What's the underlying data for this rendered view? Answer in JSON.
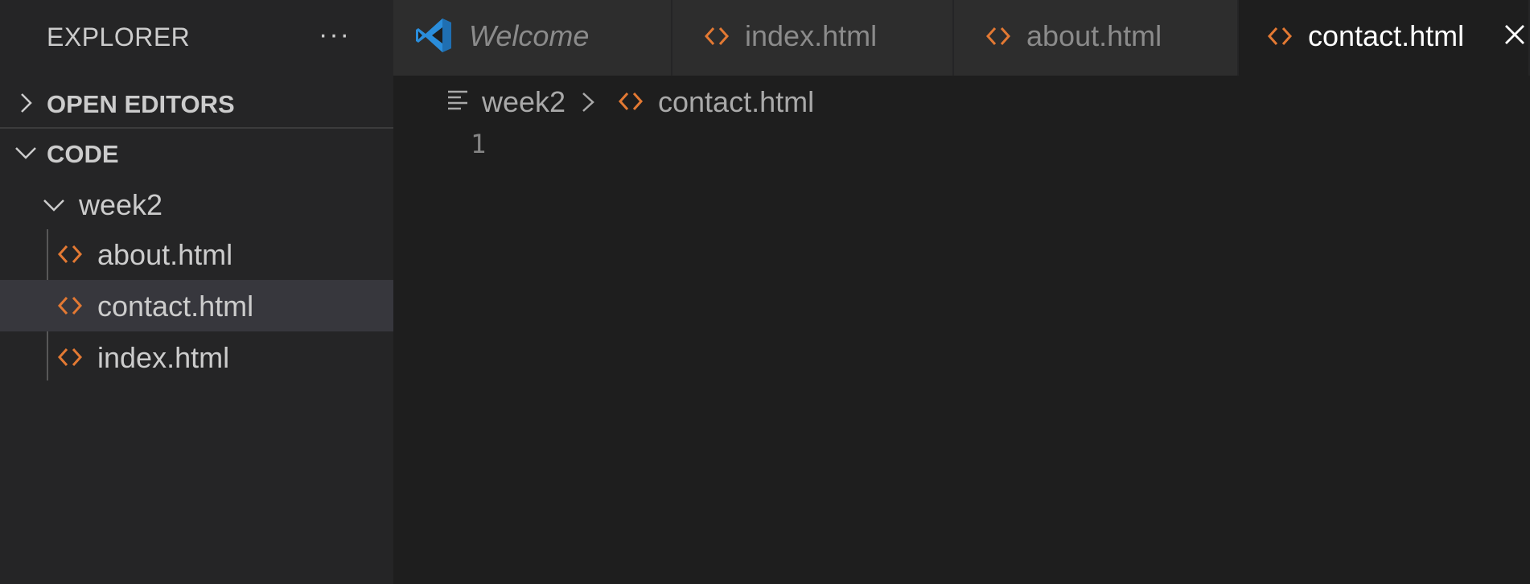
{
  "explorer": {
    "title": "EXPLORER",
    "more_label": "···",
    "sections": {
      "open_editors": "OPEN EDITORS",
      "workspace": "CODE"
    },
    "folder": "week2",
    "files": [
      {
        "name": "about.html",
        "selected": false
      },
      {
        "name": "contact.html",
        "selected": true
      },
      {
        "name": "index.html",
        "selected": false
      }
    ]
  },
  "tabs": [
    {
      "label": "Welcome",
      "icon": "vscode-logo-icon",
      "active": false
    },
    {
      "label": "index.html",
      "icon": "html-file-icon",
      "active": false
    },
    {
      "label": "about.html",
      "icon": "html-file-icon",
      "active": false
    },
    {
      "label": "contact.html",
      "icon": "html-file-icon",
      "active": true
    }
  ],
  "breadcrumb": {
    "folder": "week2",
    "file": "contact.html"
  },
  "editor": {
    "line_numbers": [
      "1"
    ]
  },
  "colors": {
    "html_icon": "#e37933",
    "vscode_blue": "#2a8ddb",
    "background": "#1e1e1e",
    "sidebar": "#252526",
    "selected_row": "#37373d"
  }
}
